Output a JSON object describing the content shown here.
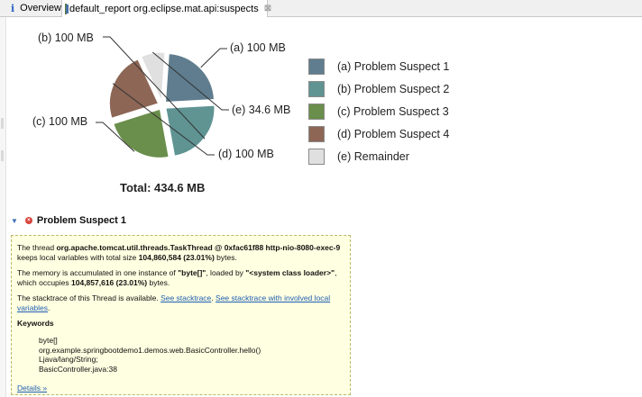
{
  "tabs": [
    {
      "label": "Overview",
      "icon": "info-icon"
    },
    {
      "label": "default_report  org.eclipse.mat.api:suspects",
      "icon": "report-icon",
      "close": "⊠"
    }
  ],
  "colors": {
    "suspect1": "#5f7d8e",
    "suspect2": "#5f9493",
    "suspect3": "#6a8e4b",
    "suspect4": "#8d6656",
    "remainder": "#e0e0e0"
  },
  "chart_data": {
    "type": "pie",
    "slices": [
      {
        "label": "(a)",
        "name": "Problem Suspect 1",
        "value": 100,
        "value_label": "100 MB"
      },
      {
        "label": "(b)",
        "name": "Problem Suspect 2",
        "value": 100,
        "value_label": "100 MB"
      },
      {
        "label": "(c)",
        "name": "Problem Suspect 3",
        "value": 100,
        "value_label": "100 MB"
      },
      {
        "label": "(d)",
        "name": "Problem Suspect 4",
        "value": 100,
        "value_label": "100 MB"
      },
      {
        "label": "(e)",
        "name": "Remainder",
        "value": 34.6,
        "value_label": "34.6 MB"
      }
    ],
    "total": "Total: 434.6 MB",
    "legend_position": "right"
  },
  "pie_labels": {
    "a": "(a)  100 MB",
    "b": "(b)  100 MB",
    "c": "(c)  100 MB",
    "d": "(d)  100 MB",
    "e": "(e)  34.6 MB"
  },
  "legend": [
    "(a)  Problem Suspect 1",
    "(b)  Problem Suspect 2",
    "(c)  Problem Suspect 3",
    "(d)  Problem Suspect 4",
    "(e)  Remainder"
  ],
  "section": {
    "title": "Problem Suspect 1"
  },
  "detail": {
    "p1_pre": "The thread ",
    "p1_bold": "org.apache.tomcat.util.threads.TaskThread @ 0xfac61f88 http-nio-8080-exec-9",
    "p1_mid": " keeps local variables with total size ",
    "p1_size": "104,860,584 (23.01%)",
    "p1_end": " bytes.",
    "p2_pre": "The memory is accumulated in one instance of ",
    "p2_bold1": "\"byte[]\"",
    "p2_mid": ", loaded by ",
    "p2_bold2": "\"<system class loader>\"",
    "p2_mid2": ", which occupies ",
    "p2_size": "104,857,616 (23.01%)",
    "p2_end": " bytes.",
    "p3_pre": "The stacktrace of this Thread is available. ",
    "link1": "See stacktrace",
    "p3_mid": ". ",
    "link2": "See stacktrace with involved local variables",
    "p3_end": ".",
    "keywords_title": "Keywords",
    "keywords": [
      "byte[]",
      "org.example.springbootdemo1.demos.web.BasicController.hello()",
      "Ljava/lang/String;",
      "BasicController.java:38"
    ],
    "details_link": "Details »"
  }
}
